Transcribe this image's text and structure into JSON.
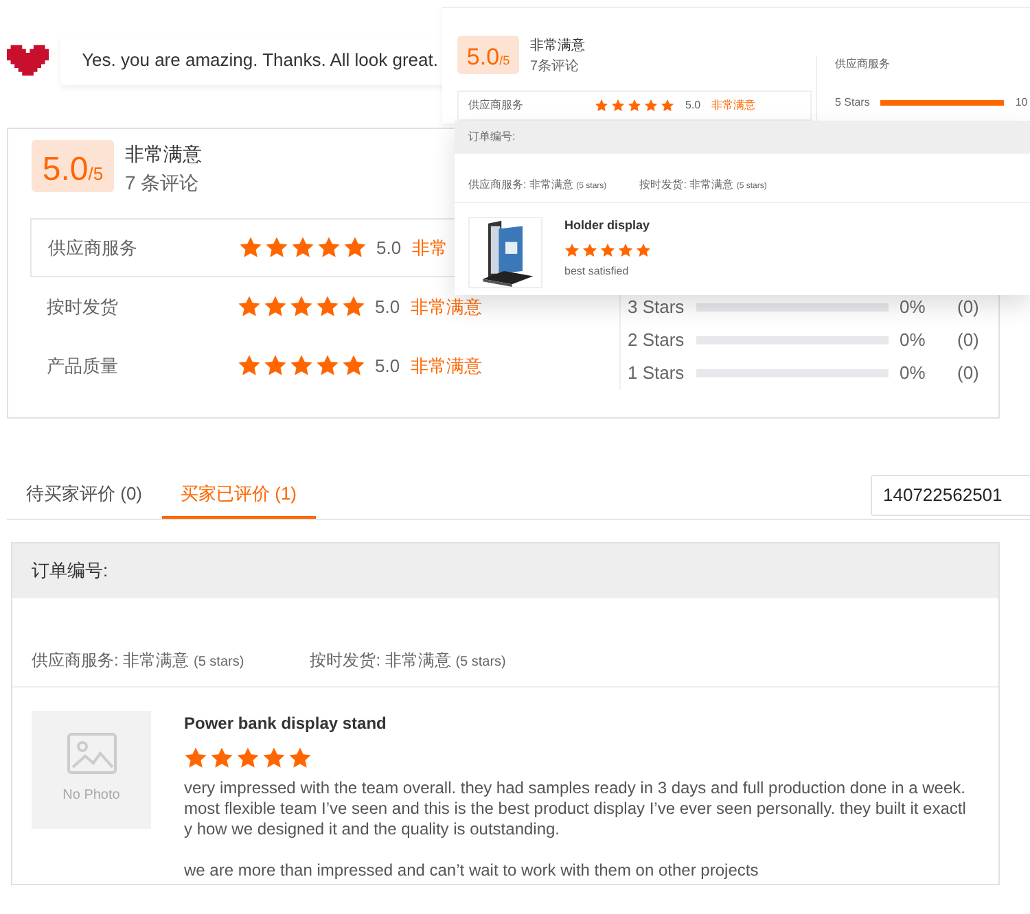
{
  "chat": {
    "message": "Yes. you are amazing. Thanks. All look great."
  },
  "summary": {
    "score": "5.0",
    "out_of": "/5",
    "verdict": "非常满意",
    "review_count": "7 条评论",
    "ratings": [
      {
        "label": "供应商服务",
        "stars": 5,
        "score": "5.0",
        "verdict": "非常",
        "selected": true
      },
      {
        "label": "按时发货",
        "stars": 5,
        "score": "5.0",
        "verdict": "非常满意",
        "selected": false
      },
      {
        "label": "产品质量",
        "stars": 5,
        "score": "5.0",
        "verdict": "非常满意",
        "selected": false
      }
    ],
    "distribution": [
      {
        "label": "3 Stars",
        "level": 0,
        "percent": "0%",
        "count": "(0)"
      },
      {
        "label": "2 Stars",
        "level": 0,
        "percent": "0%",
        "count": "(0)"
      },
      {
        "label": "1 Stars",
        "level": 0,
        "percent": "0%",
        "count": "(0)"
      }
    ]
  },
  "tabs": [
    {
      "label": "待买家评价 (0)",
      "selected": false
    },
    {
      "label": "买家已评价 (1)",
      "selected": true
    }
  ],
  "search": {
    "value": "140722562501"
  },
  "order": {
    "order_label": "订单编号:",
    "ratings": [
      {
        "label": "供应商服务:",
        "verdict": "非常满意",
        "stars_text": "(5 stars)"
      },
      {
        "label": "按时发货:",
        "verdict": "非常满意",
        "stars_text": "(5 stars)"
      }
    ],
    "review": {
      "photo_text": "No Photo",
      "title": "Power bank display stand",
      "stars": 5,
      "paragraphs": [
        "very impressed with the team overall. they had samples ready in 3 days and full production done in a week.\nmost flexible team I’ve seen and this is the best product display I’ve ever seen personally. they built it exactl\ny how we designed it and the quality is outstanding.",
        "we are more than impressed and can’t wait to work with them on other projects"
      ]
    }
  },
  "overlay_summary": {
    "score": "5.0",
    "out_of": "/5",
    "verdict": "非常满意",
    "review_count": "7条评论",
    "rating": {
      "label": "供应商服务",
      "stars": 5,
      "score": "5.0",
      "verdict": "非常满意"
    },
    "distribution_title": "供应商服务",
    "distribution": [
      {
        "label": "5 Stars",
        "level": 1,
        "percent": "10"
      }
    ]
  },
  "overlay_order": {
    "order_label": "订单编号:",
    "ratings": [
      {
        "label": "供应商服务:",
        "verdict": "非常满意",
        "stars_text": "(5 stars)"
      },
      {
        "label": "按时发货:",
        "verdict": "非常满意",
        "stars_text": "(5 stars)"
      }
    ],
    "item": {
      "kind": "picture",
      "title": "Holder display",
      "stars": 5,
      "comment": "best satisfied"
    }
  }
}
